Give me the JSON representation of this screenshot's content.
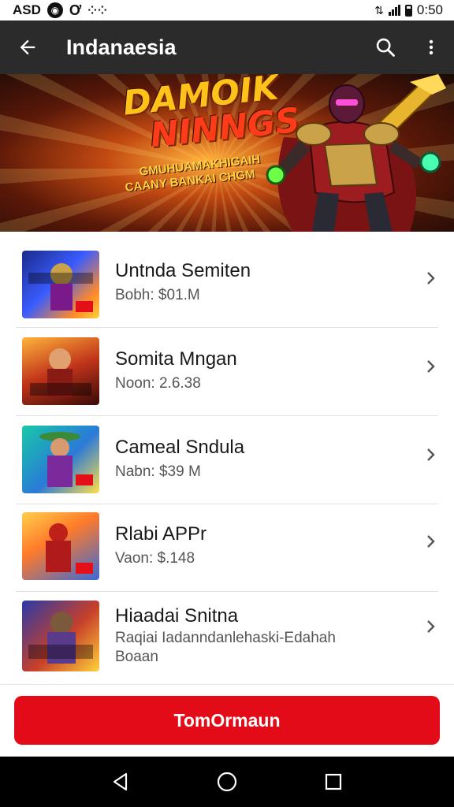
{
  "status_bar": {
    "left_text": "ASD",
    "time": "0:50",
    "icons": [
      "notification-icon",
      "sync-icon",
      "dots-icon",
      "signal-icon",
      "wifi-icon",
      "battery-icon"
    ]
  },
  "app_bar": {
    "title": "Indanaesia",
    "back_icon": "arrow-left-icon",
    "search_icon": "search-icon",
    "more_icon": "more-vert-icon",
    "background": "#2b2b2b"
  },
  "banner": {
    "title_line1": "DAMOIK",
    "title_line2": "NINNGS",
    "subtitle_line1": "GMUHUAMAKHIGAIH",
    "subtitle_line2": "CAANY BANKAI CHGM"
  },
  "list": {
    "items": [
      {
        "title": "Untnda Semiten",
        "meta": "Bobh: $01.M"
      },
      {
        "title": "Somita Mngan",
        "meta": "Noon: 2.6.38"
      },
      {
        "title": "Cameal Sndula",
        "meta": "Nabn: $39 M"
      },
      {
        "title": "Rlabi APPr",
        "meta": "Vaon: $.148"
      },
      {
        "title": "Hiaadai Snitna",
        "meta": "Raqiai Iadanndanlehaski-Edahah Boaan"
      }
    ],
    "chevron_icon": "chevron-right-icon"
  },
  "action": {
    "button_label": "TomOrmaun",
    "color": "#e30b17"
  },
  "nav_bar": {
    "icons": [
      "nav-back-icon",
      "nav-home-icon",
      "nav-recents-icon"
    ]
  }
}
